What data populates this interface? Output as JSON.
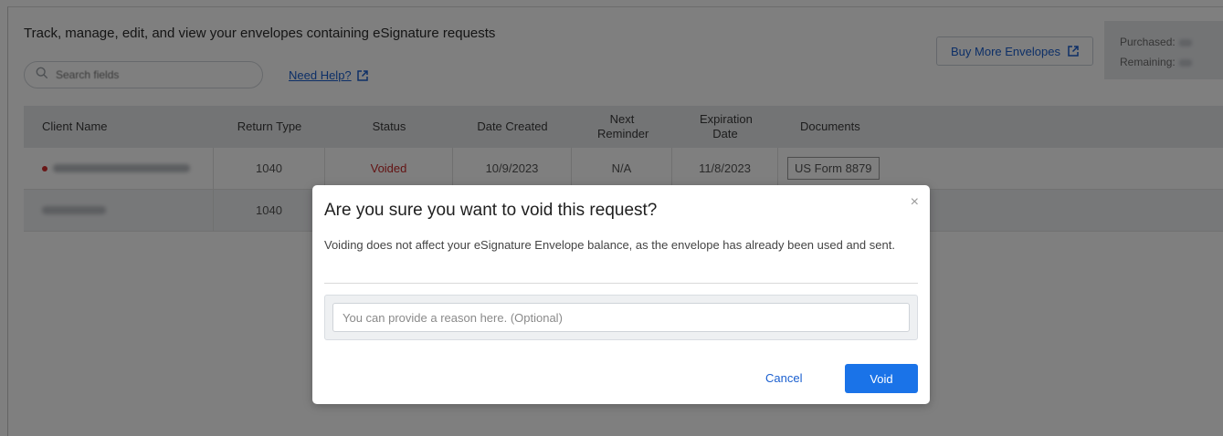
{
  "page": {
    "heading": "Track, manage, edit, and view your envelopes containing eSignature requests",
    "search_placeholder": "Search fields",
    "help_link": "Need Help?",
    "buy_button": "Buy More Envelopes",
    "purchased_label": "Purchased:",
    "remaining_label": "Remaining:"
  },
  "table": {
    "headers": {
      "client_name": "Client Name",
      "return_type": "Return Type",
      "status": "Status",
      "date_created": "Date Created",
      "next_reminder": "Next Reminder",
      "expiration_date": "Expiration Date",
      "documents": "Documents"
    },
    "rows": [
      {
        "return_type": "1040",
        "status": "Voided",
        "date_created": "10/9/2023",
        "next_reminder": "N/A",
        "expiration_date": "11/8/2023",
        "document": "US Form 8879"
      },
      {
        "return_type": "1040"
      }
    ]
  },
  "modal": {
    "title": "Are you sure you want to void this request?",
    "close": "×",
    "body": "Voiding does not affect your eSignature Envelope balance, as the envelope has already been used and sent.",
    "reason_placeholder": "You can provide a reason here. (Optional)",
    "cancel_label": "Cancel",
    "void_label": "Void"
  },
  "colors": {
    "accent": "#1a73e8",
    "link": "#1a5fcf",
    "voided": "#c62828",
    "overlay": "rgba(0,0,0,0.5)"
  }
}
